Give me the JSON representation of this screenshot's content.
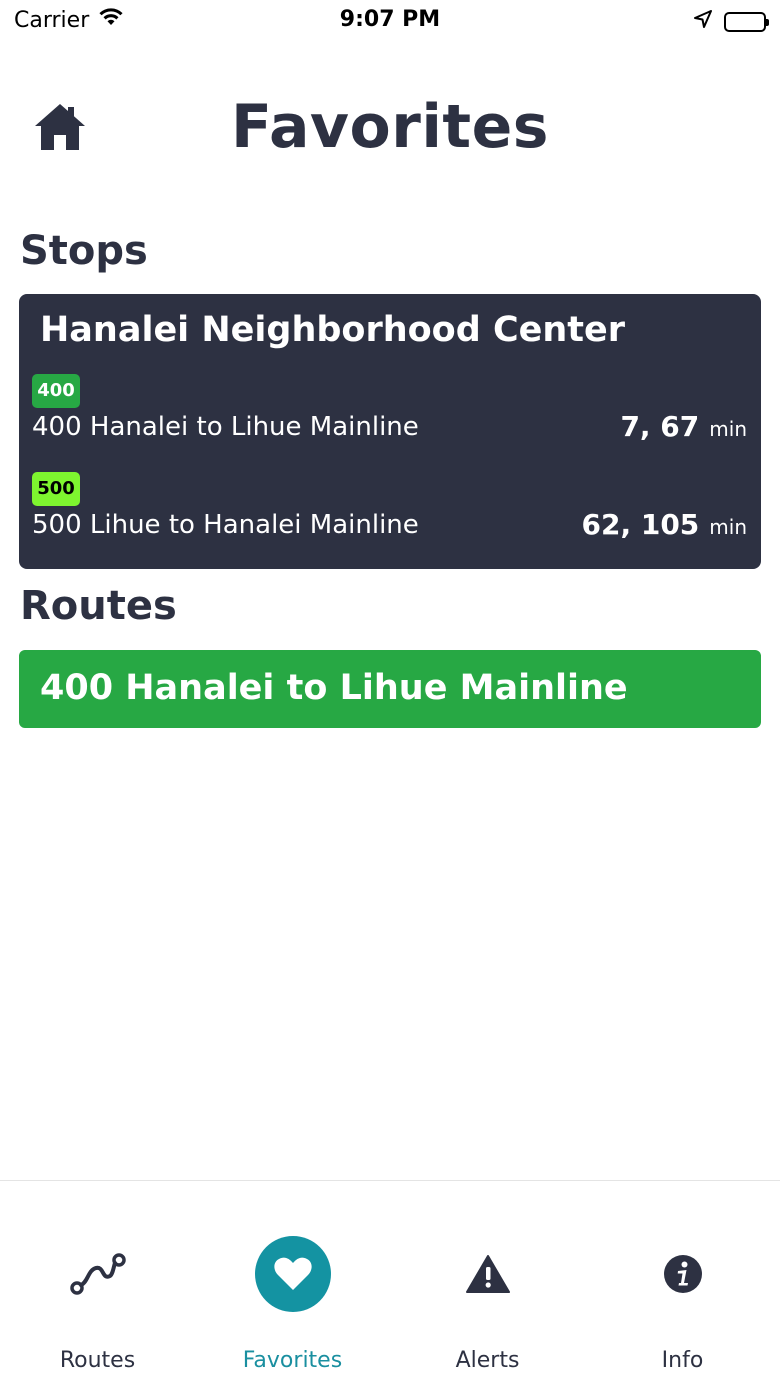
{
  "status_bar": {
    "carrier": "Carrier",
    "time": "9:07 PM"
  },
  "header": {
    "title": "Favorites",
    "home_icon": "home-icon"
  },
  "stops": {
    "section_title": "Stops",
    "items": [
      {
        "name": "Hanalei Neighborhood Center",
        "arrivals": [
          {
            "badge": "400",
            "badge_color": "#27a844",
            "badge_text_color": "#ffffff",
            "route": "400 Hanalei to Lihue Mainline",
            "times": "7, 67",
            "unit": "min"
          },
          {
            "badge": "500",
            "badge_color": "#7ef52f",
            "badge_text_color": "#000000",
            "route": "500 Lihue to Hanalei Mainline",
            "times": "62, 105",
            "unit": "min"
          }
        ]
      }
    ]
  },
  "routes": {
    "section_title": "Routes",
    "items": [
      {
        "label": "400 Hanalei to Lihue Mainline",
        "color": "#27a844"
      }
    ]
  },
  "tab_bar": {
    "tabs": [
      {
        "label": "Routes",
        "icon": "route-icon",
        "active": false
      },
      {
        "label": "Favorites",
        "icon": "heart-icon",
        "active": true
      },
      {
        "label": "Alerts",
        "icon": "alert-icon",
        "active": false
      },
      {
        "label": "Info",
        "icon": "info-icon",
        "active": false
      }
    ]
  },
  "colors": {
    "dark": "#2d3142",
    "accent": "#1493a2",
    "route_green": "#27a844"
  }
}
